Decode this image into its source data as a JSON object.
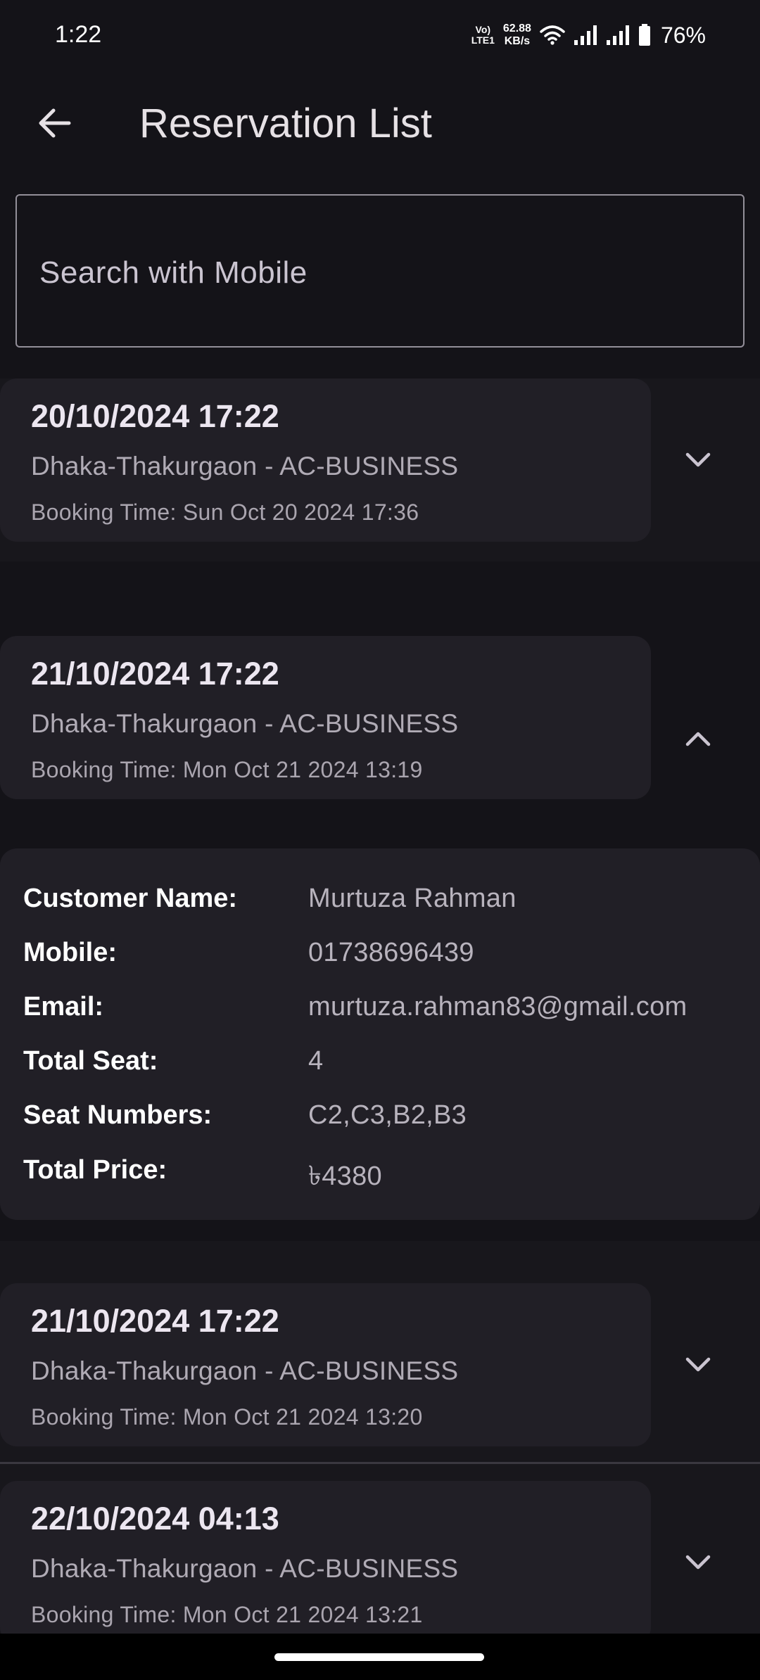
{
  "status_bar": {
    "time": "1:22",
    "volte_top": "Vo)",
    "volte_bottom": "LTE1",
    "net_speed_value": "62.88",
    "net_speed_unit": "KB/s",
    "battery_percent": "76%",
    "icons": [
      "wifi-icon",
      "signal-icon",
      "signal-icon",
      "battery-icon"
    ]
  },
  "app_bar": {
    "back_icon": "arrow-left-icon",
    "title": "Reservation List"
  },
  "search": {
    "placeholder": "Search with Mobile",
    "value": ""
  },
  "reservations": [
    {
      "date": "20/10/2024 17:22",
      "route": "Dhaka-Thakurgaon - AC-BUSINESS",
      "booking_time": "Booking Time: Sun Oct 20 2024 17:36",
      "expanded": false,
      "toggle_icon": "chevron-down-icon"
    },
    {
      "date": "21/10/2024 17:22",
      "route": "Dhaka-Thakurgaon - AC-BUSINESS",
      "booking_time": "Booking Time: Mon Oct 21 2024 13:19",
      "expanded": true,
      "toggle_icon": "chevron-up-icon"
    },
    {
      "date": "21/10/2024 17:22",
      "route": "Dhaka-Thakurgaon - AC-BUSINESS",
      "booking_time": "Booking Time: Mon Oct 21 2024 13:20",
      "expanded": false,
      "toggle_icon": "chevron-down-icon"
    },
    {
      "date": "22/10/2024 04:13",
      "route": "Dhaka-Thakurgaon - AC-BUSINESS",
      "booking_time": "Booking Time: Mon Oct 21 2024 13:21",
      "expanded": false,
      "toggle_icon": "chevron-down-icon"
    }
  ],
  "details": {
    "customer_name": {
      "label": "Customer Name:",
      "value": "Murtuza Rahman"
    },
    "mobile": {
      "label": "Mobile:",
      "value": "01738696439"
    },
    "email": {
      "label": "Email:",
      "value": "murtuza.rahman83@gmail.com"
    },
    "total_seat": {
      "label": "Total Seat:",
      "value": "4"
    },
    "seat_numbers": {
      "label": "Seat Numbers:",
      "value": "C2,C3,B2,B3"
    },
    "total_price": {
      "label": "Total Price:",
      "value": "৳4380"
    }
  },
  "colors": {
    "background": "#141318",
    "card": "#211f26",
    "text_primary": "#e6e1e5",
    "text_secondary": "#b0abb5",
    "outline": "#938f99"
  }
}
